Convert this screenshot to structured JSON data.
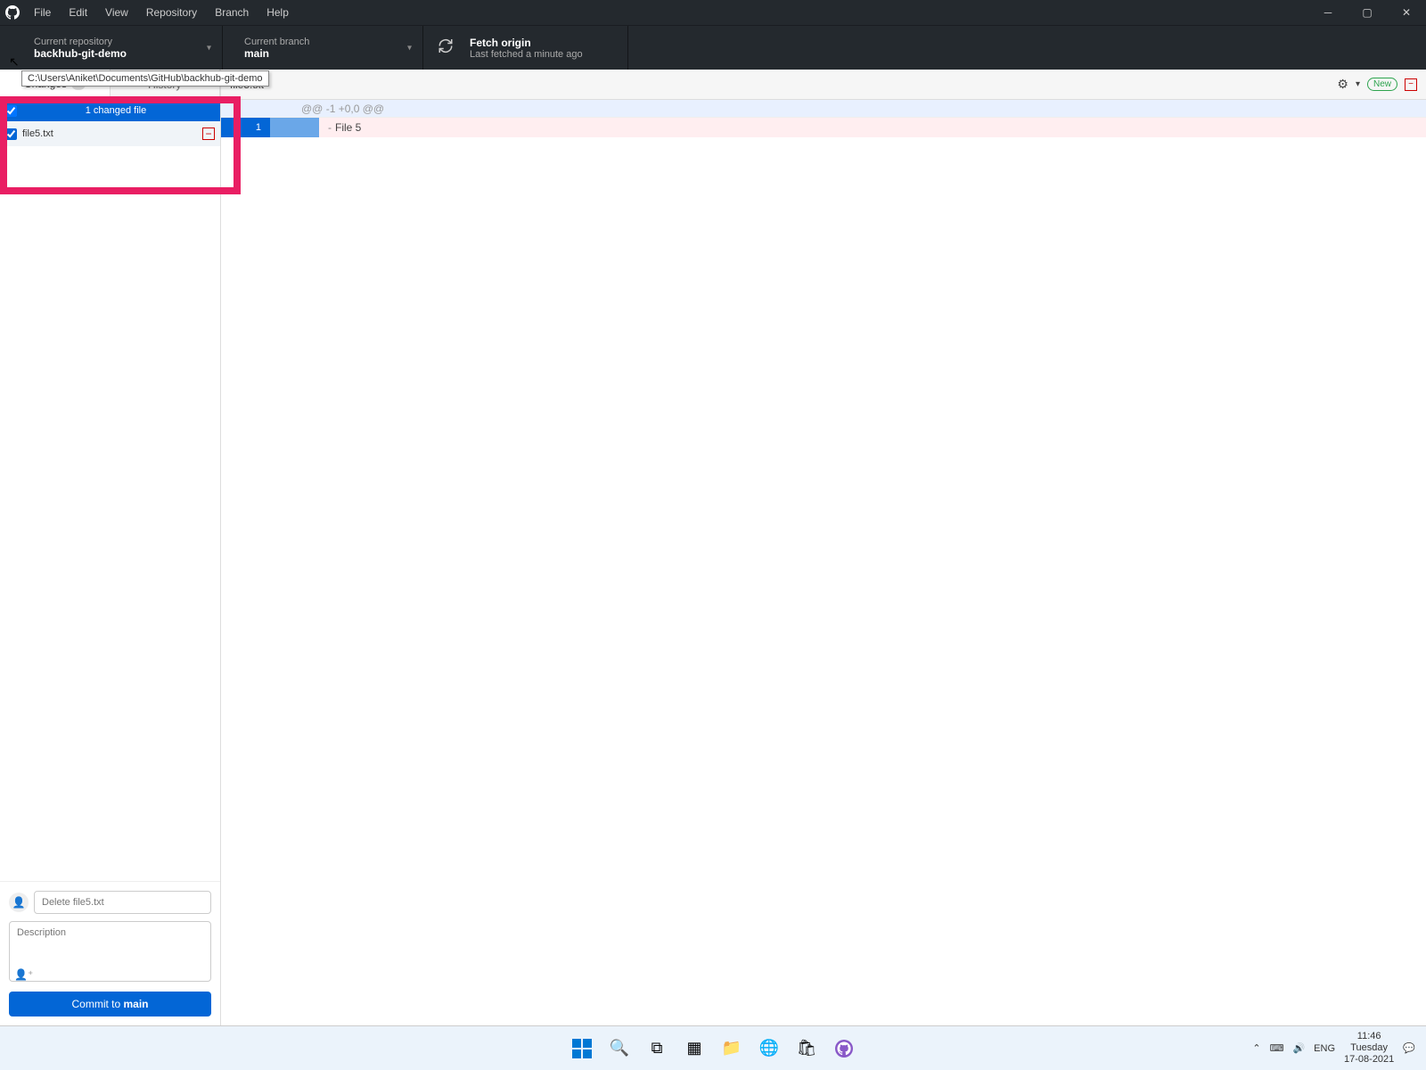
{
  "menu": {
    "items": [
      "File",
      "Edit",
      "View",
      "Repository",
      "Branch",
      "Help"
    ]
  },
  "toolbar": {
    "repo": {
      "label": "Current repository",
      "value": "backhub-git-demo",
      "tooltip": "C:\\Users\\Aniket\\Documents\\GitHub\\backhub-git-demo"
    },
    "branch": {
      "label": "Current branch",
      "value": "main"
    },
    "fetch": {
      "label": "Fetch origin",
      "value": "Last fetched a minute ago"
    }
  },
  "tabs": {
    "changes": "Changes",
    "changes_count": "1",
    "history": "History"
  },
  "filelist": {
    "header": "1 changed file",
    "items": [
      {
        "name": "file5.txt"
      }
    ]
  },
  "diff": {
    "filename": "file5.txt",
    "hunk_header": "@@ -1 +0,0 @@",
    "line_number": "1",
    "line_content": "File 5",
    "new_label": "New"
  },
  "commit": {
    "summary_placeholder": "Delete file5.txt",
    "desc_placeholder": "Description",
    "button_prefix": "Commit to ",
    "button_branch": "main"
  },
  "tray": {
    "lang": "ENG",
    "time": "11:46",
    "day": "Tuesday",
    "date": "17-08-2021"
  }
}
